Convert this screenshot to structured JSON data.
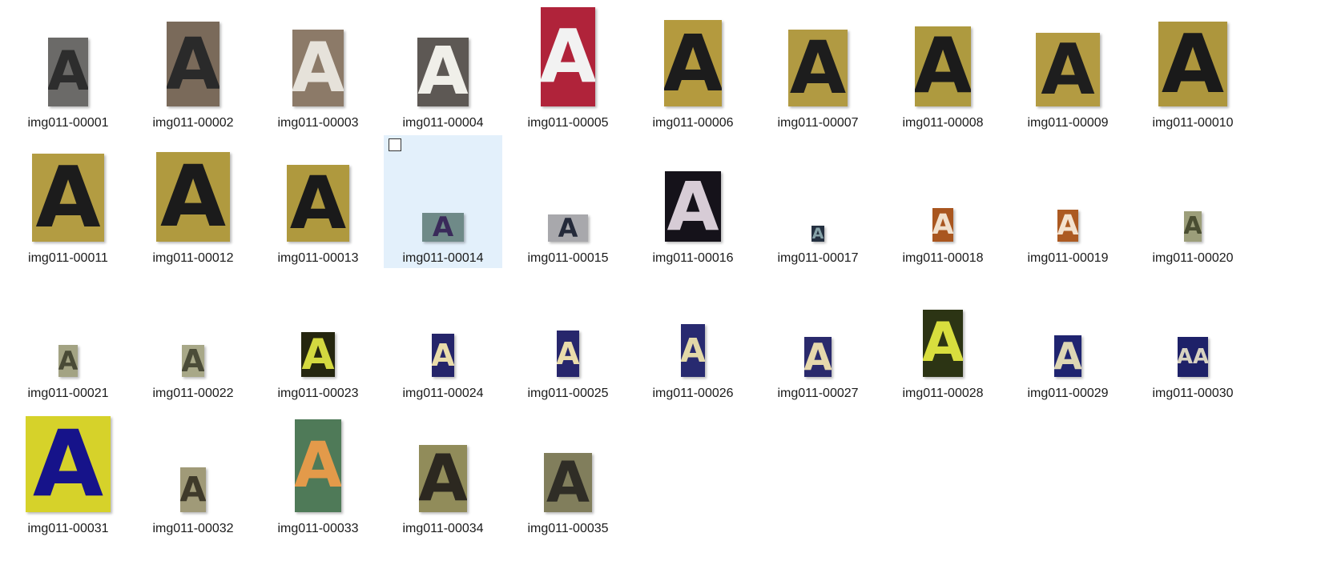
{
  "files": [
    {
      "name": "img011-00001",
      "bg": "#6b6a68",
      "fg": "#2d2d2d",
      "glyph": "A"
    },
    {
      "name": "img011-00002",
      "bg": "#7a6a5a",
      "fg": "#2a2a2a",
      "glyph": "A"
    },
    {
      "name": "img011-00003",
      "bg": "#8c7a68",
      "fg": "#e6e2da",
      "glyph": "A"
    },
    {
      "name": "img011-00004",
      "bg": "#5d5854",
      "fg": "#f0efe9",
      "glyph": "A"
    },
    {
      "name": "img011-00005",
      "bg": "#b0233a",
      "fg": "#f2f2f2",
      "glyph": "A"
    },
    {
      "name": "img011-00006",
      "bg": "#b49a3e",
      "fg": "#1c1c1c",
      "glyph": "A"
    },
    {
      "name": "img011-00007",
      "bg": "#b19a42",
      "fg": "#1d1d1d",
      "glyph": "A"
    },
    {
      "name": "img011-00008",
      "bg": "#ae9a3f",
      "fg": "#1b1b1b",
      "glyph": "A"
    },
    {
      "name": "img011-00009",
      "bg": "#b39b42",
      "fg": "#1e1e1e",
      "glyph": "A"
    },
    {
      "name": "img011-00010",
      "bg": "#ad963d",
      "fg": "#1a1a1a",
      "glyph": "A"
    },
    {
      "name": "img011-00011",
      "bg": "#b39c42",
      "fg": "#1c1c1c",
      "glyph": "A"
    },
    {
      "name": "img011-00012",
      "bg": "#b09a3f",
      "fg": "#1b1b1b",
      "glyph": "A"
    },
    {
      "name": "img011-00013",
      "bg": "#af993e",
      "fg": "#1a1a1a",
      "glyph": "A"
    },
    {
      "name": "img011-00014",
      "bg": "#6f8a88",
      "fg": "#3a2a5a",
      "glyph": "A"
    },
    {
      "name": "img011-00015",
      "bg": "#a8a8ac",
      "fg": "#242a3a",
      "glyph": "A"
    },
    {
      "name": "img011-00016",
      "bg": "#15121a",
      "fg": "#d7ccd6",
      "glyph": "A"
    },
    {
      "name": "img011-00017",
      "bg": "#243040",
      "fg": "#86a2a8",
      "glyph": "A"
    },
    {
      "name": "img011-00018",
      "bg": "#a9561f",
      "fg": "#f1e0cc",
      "glyph": "A"
    },
    {
      "name": "img011-00019",
      "bg": "#ac5a22",
      "fg": "#f3e2cf",
      "glyph": "A"
    },
    {
      "name": "img011-00020",
      "bg": "#9c9e7a",
      "fg": "#4a4e32",
      "glyph": "A"
    },
    {
      "name": "img011-00021",
      "bg": "#a3a383",
      "fg": "#494a36",
      "glyph": "A"
    },
    {
      "name": "img011-00022",
      "bg": "#a8a888",
      "fg": "#4b4c38",
      "glyph": "A"
    },
    {
      "name": "img011-00023",
      "bg": "#25260f",
      "fg": "#d4d940",
      "glyph": "A"
    },
    {
      "name": "img011-00024",
      "bg": "#25256a",
      "fg": "#e9dcaa",
      "glyph": "A"
    },
    {
      "name": "img011-00025",
      "bg": "#27266c",
      "fg": "#eadcab",
      "glyph": "A"
    },
    {
      "name": "img011-00026",
      "bg": "#282a70",
      "fg": "#e2d8a8",
      "glyph": "A"
    },
    {
      "name": "img011-00027",
      "bg": "#2a2a6c",
      "fg": "#e6d8ac",
      "glyph": "A"
    },
    {
      "name": "img011-00028",
      "bg": "#2c3414",
      "fg": "#d8de3e",
      "glyph": "A"
    },
    {
      "name": "img011-00029",
      "bg": "#1f2470",
      "fg": "#ddd6b4",
      "glyph": "A"
    },
    {
      "name": "img011-00030",
      "bg": "#1e2168",
      "fg": "#d8d2c0",
      "glyph": "AA"
    },
    {
      "name": "img011-00031",
      "bg": "#d6d22a",
      "fg": "#16138a",
      "glyph": "A"
    },
    {
      "name": "img011-00032",
      "bg": "#a09a78",
      "fg": "#3f3a2a",
      "glyph": "A"
    },
    {
      "name": "img011-00033",
      "bg": "#4f7a58",
      "fg": "#e39a4a",
      "glyph": "A"
    },
    {
      "name": "img011-00034",
      "bg": "#918c5a",
      "fg": "#2c2820",
      "glyph": "A"
    },
    {
      "name": "img011-00035",
      "bg": "#817e5c",
      "fg": "#2f2d26",
      "glyph": "A"
    }
  ],
  "selected": "img011-00014"
}
